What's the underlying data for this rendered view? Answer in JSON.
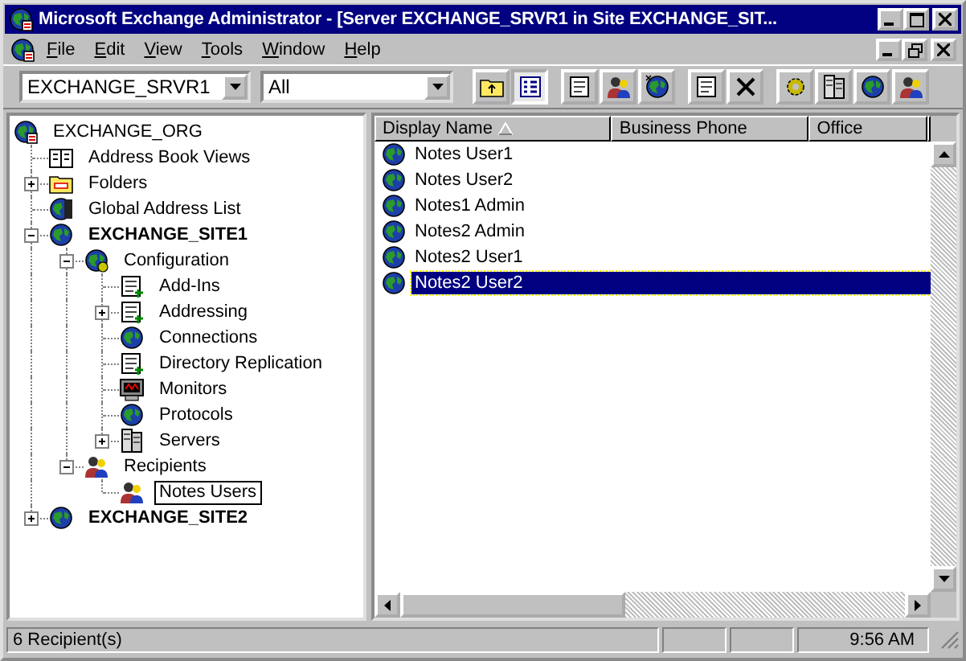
{
  "window": {
    "title": "Microsoft Exchange Administrator - [Server EXCHANGE_SRVR1 in Site EXCHANGE_SIT..."
  },
  "menu": [
    "File",
    "Edit",
    "View",
    "Tools",
    "Window",
    "Help"
  ],
  "toolbar": {
    "server_combo": {
      "value": "EXCHANGE_SRVR1"
    },
    "filter_combo": {
      "value": "All"
    },
    "buttons": [
      {
        "pressed": false
      },
      {
        "pressed": true
      },
      {
        "pressed": false
      },
      {
        "pressed": false
      },
      {
        "pressed": false
      },
      {
        "pressed": false
      },
      {
        "pressed": false
      },
      {
        "pressed": false
      },
      {
        "pressed": false
      },
      {
        "pressed": false
      },
      {
        "pressed": false
      }
    ]
  },
  "tree": [
    {
      "label": "EXCHANGE_ORG",
      "bold": false,
      "selected": false,
      "children": [
        {
          "label": "Address Book Views",
          "bold": false,
          "selected": false
        },
        {
          "label": "Folders",
          "bold": false,
          "selected": false,
          "expanded": false
        },
        {
          "label": "Global Address List",
          "bold": false,
          "selected": false
        },
        {
          "label": "EXCHANGE_SITE1",
          "bold": true,
          "selected": false,
          "expanded": true,
          "children": [
            {
              "label": "Configuration",
              "bold": false,
              "selected": false,
              "expanded": true,
              "children": [
                {
                  "label": "Add-Ins",
                  "bold": false,
                  "selected": false
                },
                {
                  "label": "Addressing",
                  "bold": false,
                  "selected": false,
                  "expanded": false
                },
                {
                  "label": "Connections",
                  "bold": false,
                  "selected": false
                },
                {
                  "label": "Directory Replication",
                  "bold": false,
                  "selected": false
                },
                {
                  "label": "Monitors",
                  "bold": false,
                  "selected": false
                },
                {
                  "label": "Protocols",
                  "bold": false,
                  "selected": false
                },
                {
                  "label": "Servers",
                  "bold": false,
                  "selected": false,
                  "expanded": false
                }
              ]
            },
            {
              "label": "Recipients",
              "bold": false,
              "selected": false,
              "expanded": true,
              "children": [
                {
                  "label": "Notes Users",
                  "bold": false,
                  "selected": true
                }
              ]
            }
          ]
        },
        {
          "label": "EXCHANGE_SITE2",
          "bold": true,
          "selected": false,
          "expanded": false
        }
      ]
    }
  ],
  "list": {
    "columns": [
      {
        "label": "Display Name",
        "sorted": true
      },
      {
        "label": "Business Phone",
        "sorted": false
      },
      {
        "label": "Office",
        "sorted": false
      }
    ],
    "rows": [
      {
        "name": "Notes User1",
        "selected": false
      },
      {
        "name": "Notes User2",
        "selected": false
      },
      {
        "name": "Notes1 Admin",
        "selected": false
      },
      {
        "name": "Notes2 Admin",
        "selected": false
      },
      {
        "name": "Notes2 User1",
        "selected": false
      },
      {
        "name": "Notes2 User2",
        "selected": true
      }
    ]
  },
  "status_bar": {
    "text": "6 Recipient(s)",
    "time": "9:56 AM"
  }
}
